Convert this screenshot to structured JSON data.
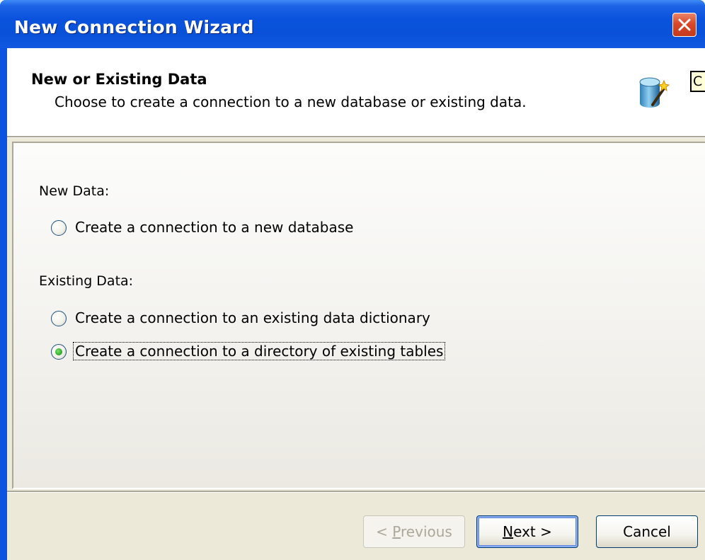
{
  "window": {
    "title": "New Connection Wizard"
  },
  "header": {
    "title": "New or Existing Data",
    "subtitle": "Choose to create a connection to a new database or existing data.",
    "icon": "database-wand-icon",
    "clipped_text": "C"
  },
  "new_data": {
    "label": "New Data:",
    "options": [
      {
        "label": "Create a connection to a new database",
        "selected": false
      }
    ]
  },
  "existing_data": {
    "label": "Existing Data:",
    "options": [
      {
        "label": "Create a connection to an existing data dictionary",
        "selected": false
      },
      {
        "label": "Create a connection to a directory of existing tables",
        "selected": true
      }
    ]
  },
  "buttons": {
    "previous": {
      "prefix": "< ",
      "mnemonic": "P",
      "rest": "revious",
      "enabled": false
    },
    "next": {
      "mnemonic": "N",
      "rest": "ext >",
      "enabled": true
    },
    "cancel": {
      "label": "Cancel",
      "enabled": true
    }
  },
  "colors": {
    "titlebar": "#0a52dc",
    "close_button": "#d8482a",
    "dialog_face": "#ece9d8",
    "radio_selected": "#30ae2a"
  }
}
